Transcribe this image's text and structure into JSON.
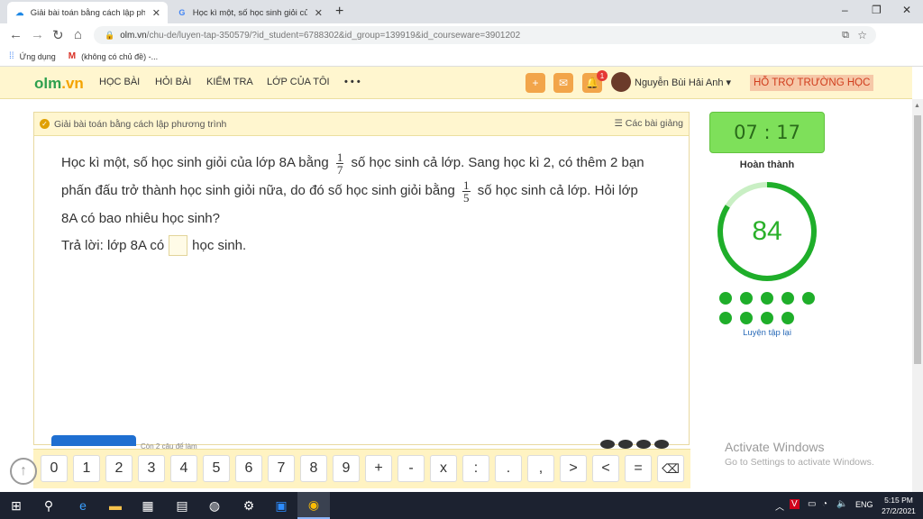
{
  "browser": {
    "tabs": [
      {
        "title": "Giải bài toán bằng cách lập phương",
        "icon": "cloud-icon"
      },
      {
        "title": "Học kì một, số học sinh giỏi của",
        "icon": "google-icon"
      }
    ],
    "tab_close": "✕",
    "new_tab": "+",
    "window_controls": [
      "–",
      "❐",
      "✕"
    ],
    "url_host": "olm.vn",
    "url_path": "/chu-de/luyen-tap-350579/?id_student=6788302&id_group=139919&id_courseware=3901202",
    "bookmarks": [
      {
        "label": "Ứng dụng",
        "icon": "apps-grid-icon"
      },
      {
        "label": "(không có chủ đề) -...",
        "icon": "gmail-icon"
      }
    ]
  },
  "site": {
    "logo_part1": "olm",
    "logo_part2": ".vn",
    "nav": [
      "HỌC BÀI",
      "HỎI BÀI",
      "KIỂM TRA",
      "LỚP CỦA TÔI",
      "• • •"
    ],
    "notification_count": "1",
    "user_name": "Nguyễn Bùi Hải Anh ▾",
    "support_label": "HỖ TRỢ TRƯỜNG HỌC"
  },
  "lesson": {
    "title": "Giải bài toán bằng cách lập phương trình",
    "lectures_label": "Các bài giảng",
    "question": {
      "p1": "Học kì một, số học sinh giỏi của lớp 8A bằng",
      "frac1_num": "1",
      "frac1_den": "7",
      "p2": "số học sinh cả lớp. Sang học kì 2, có thêm 2 bạn phấn đấu trở thành học sinh giỏi nữa, do đó số học sinh giỏi bằng",
      "frac2_num": "1",
      "frac2_den": "5",
      "p3": "số học sinh cả lớp. Hỏi lớp 8A có bao nhiêu học sinh?"
    },
    "answer_prefix": "Trả lời: lớp 8A có",
    "answer_suffix": "học sinh.",
    "remaining": "Còn 2 câu để làm"
  },
  "side": {
    "timer": "07 : 17",
    "complete_label": "Hoàn thành",
    "score": "84",
    "score_progress": 0.84,
    "retry_label": "Luyện tập lại",
    "dots_count": 9
  },
  "keypad": {
    "keys": [
      "0",
      "1",
      "2",
      "3",
      "4",
      "5",
      "6",
      "7",
      "8",
      "9",
      "+",
      "-",
      "x",
      ":",
      ".",
      ",",
      ">",
      "<",
      "="
    ],
    "backspace": "⌫"
  },
  "watermark": {
    "line1": "Activate Windows",
    "line2": "Go to Settings to activate Windows."
  },
  "taskbar": {
    "language": "ENG",
    "time": "5:15 PM",
    "date": "27/2/2021"
  },
  "colors": {
    "accent_green": "#1fae2a",
    "header_yellow": "#fff6cf",
    "timer_green": "#7ee05a",
    "support_red": "#d03c1c"
  }
}
